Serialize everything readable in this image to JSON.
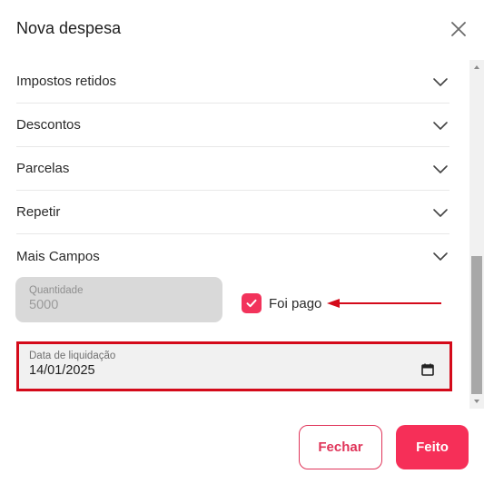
{
  "modal": {
    "title": "Nova despesa"
  },
  "sections": [
    {
      "label": "Impostos retidos"
    },
    {
      "label": "Descontos"
    },
    {
      "label": "Parcelas"
    },
    {
      "label": "Repetir"
    },
    {
      "label": "Mais Campos"
    }
  ],
  "quantity": {
    "label": "Quantidade",
    "value": "5000"
  },
  "paid": {
    "label": "Foi pago",
    "checked": true
  },
  "settlement_date": {
    "label": "Data de liquidação",
    "value": "14/01/2025"
  },
  "footer": {
    "close_label": "Fechar",
    "done_label": "Feito"
  },
  "colors": {
    "accent": "#f62f58",
    "annotation": "#d40a1a"
  },
  "icons": {
    "close": "close-icon",
    "expand": "chevron-down-icon",
    "checkbox": "check-icon",
    "calendar": "calendar-icon"
  }
}
